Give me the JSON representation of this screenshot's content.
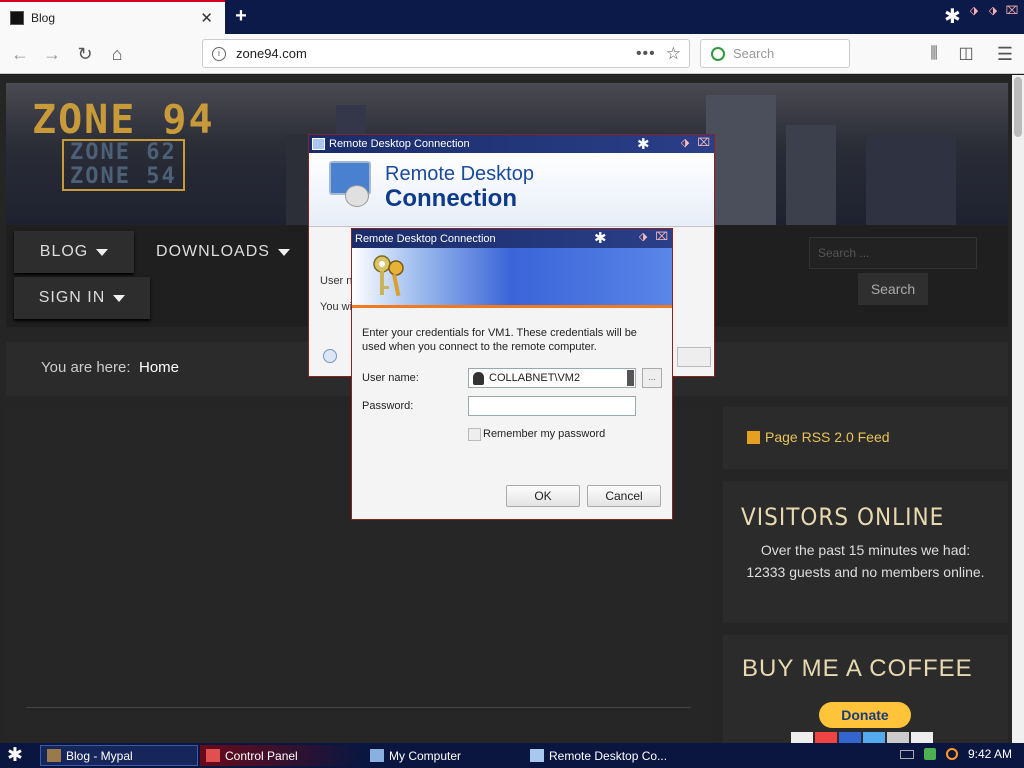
{
  "browser": {
    "tab_title": "Blog",
    "url": "zone94.com",
    "search_placeholder": "Search",
    "page_actions": "•••"
  },
  "site": {
    "logo_main": "ZONE 94",
    "logo_sub1": "ZONE 62",
    "logo_sub2": "ZONE 54",
    "menu": [
      {
        "label": "BLOG"
      },
      {
        "label": "DOWNLOADS"
      },
      {
        "label": "SIGN IN"
      }
    ],
    "search_placeholder": "Search ...",
    "search_button": "Search",
    "breadcrumb_label": "You are here:",
    "breadcrumb_home": "Home",
    "rss_link": "Page RSS 2.0 Feed",
    "visitors_heading": "VISITORS ONLINE",
    "visitors_text": "Over the past 15 minutes we had: 12333 guests and no members online.",
    "coffee_heading": "BUY ME A COFFEE",
    "donate_label": "Donate"
  },
  "rdp_main": {
    "title": "Remote Desktop Connection",
    "heading_line1": "Remote Desktop",
    "heading_line2": "Connection",
    "ghost_user": "User n",
    "ghost_you": "You wi"
  },
  "rdp_cred": {
    "title": "Remote Desktop Connection",
    "message": "Enter your credentials for VM1. These credentials will be used when you connect to the remote computer.",
    "username_label": "User name:",
    "username_value": "COLLABNET\\VM2",
    "password_label": "Password:",
    "remember_label": "Remember my password",
    "ok_label": "OK",
    "cancel_label": "Cancel",
    "browse_label": "..."
  },
  "taskbar": {
    "items": [
      {
        "label": "Blog - Mypal"
      },
      {
        "label": "Control Panel"
      },
      {
        "label": "My Computer"
      },
      {
        "label": "Remote Desktop Co..."
      }
    ],
    "clock": "9:42 AM"
  },
  "colors": {
    "accent": "#d70022",
    "site_gold": "#e8c35a",
    "rdp_blue": "#1a4a9a",
    "taskbar": "#0a1640"
  }
}
